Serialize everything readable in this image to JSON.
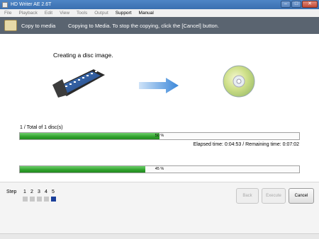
{
  "window": {
    "title": "HD Writer AE 2.6T"
  },
  "menu": [
    "File",
    "Playback",
    "Edit",
    "View",
    "Tools",
    "Output",
    "Support",
    "Manual"
  ],
  "mode": {
    "title": "Copy to media",
    "message": "Copying to Media. To stop the copying, click the [Cancel] button."
  },
  "main": {
    "heading": "Creating a disc image.",
    "disc_count": "1 / Total of 1 disc(s)",
    "progress1": {
      "label": "50 %",
      "value": 0.5
    },
    "elapsed": "Elapsed time: 0:04:53 / Remaining time: 0:07:02",
    "progress2": {
      "label": "45 %",
      "value": 0.45
    }
  },
  "footer": {
    "step_label": "Step",
    "steps": [
      "1",
      "2",
      "3",
      "4",
      "5"
    ],
    "active_step": 5,
    "back": "Back",
    "execute": "Execute",
    "cancel": "Cancel"
  },
  "colors": {
    "progress": "#2fa02c",
    "active_step": "#1a3f9a",
    "mode_bar": "#5a6470"
  }
}
